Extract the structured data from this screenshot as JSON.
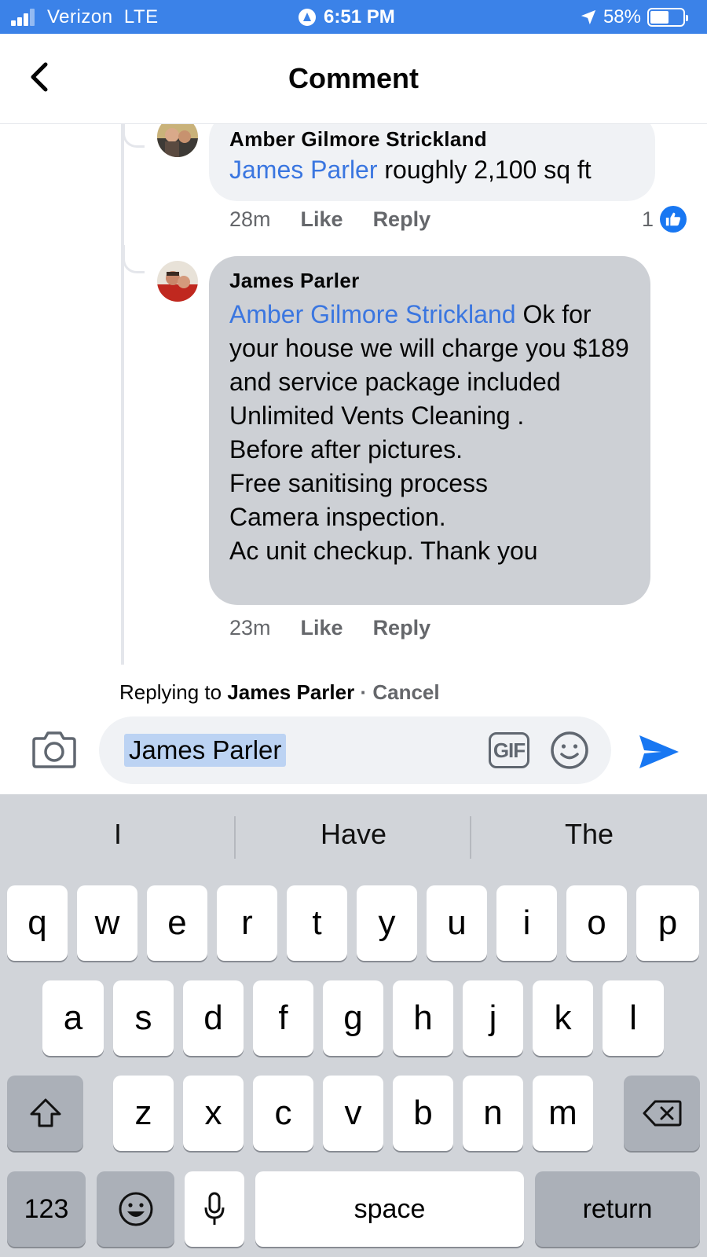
{
  "status_bar": {
    "carrier": "Verizon  LTE",
    "time": "6:51 PM",
    "battery": "58%",
    "battery_level": 0.58
  },
  "header": {
    "title": "Comment"
  },
  "comments": [
    {
      "author": "Amber Gilmore Strickland",
      "mention": "James Parler",
      "text": " roughly 2,100 sq ft",
      "time": "28m",
      "like_label": "Like",
      "reply_label": "Reply",
      "reaction_count": "1"
    },
    {
      "author": "James Parler",
      "mention": "Amber Gilmore Strickland",
      "text_lines": [
        " Ok for your house we will charge you $189 and service package included",
        "Unlimited Vents Cleaning .",
        "Before after pictures.",
        "Free sanitising process",
        "Camera inspection.",
        "Ac unit checkup. Thank you"
      ],
      "time": "23m",
      "like_label": "Like",
      "reply_label": "Reply"
    }
  ],
  "reply": {
    "prefix": "Replying to ",
    "target": "James Parler",
    "separator": " · ",
    "cancel": "Cancel",
    "input_value": "James Parler",
    "gif_label": "GIF"
  },
  "keyboard": {
    "predictions": [
      "I",
      "Have",
      "The"
    ],
    "row1": [
      "q",
      "w",
      "e",
      "r",
      "t",
      "y",
      "u",
      "i",
      "o",
      "p"
    ],
    "row2": [
      "a",
      "s",
      "d",
      "f",
      "g",
      "h",
      "j",
      "k",
      "l"
    ],
    "row3": [
      "z",
      "x",
      "c",
      "v",
      "b",
      "n",
      "m"
    ],
    "numbers": "123",
    "space": "space",
    "return": "return"
  },
  "colors": {
    "status_bar": "#3b82e8",
    "mention": "#3a76e0",
    "like_blue": "#1877f2",
    "send_blue": "#1877f2"
  }
}
